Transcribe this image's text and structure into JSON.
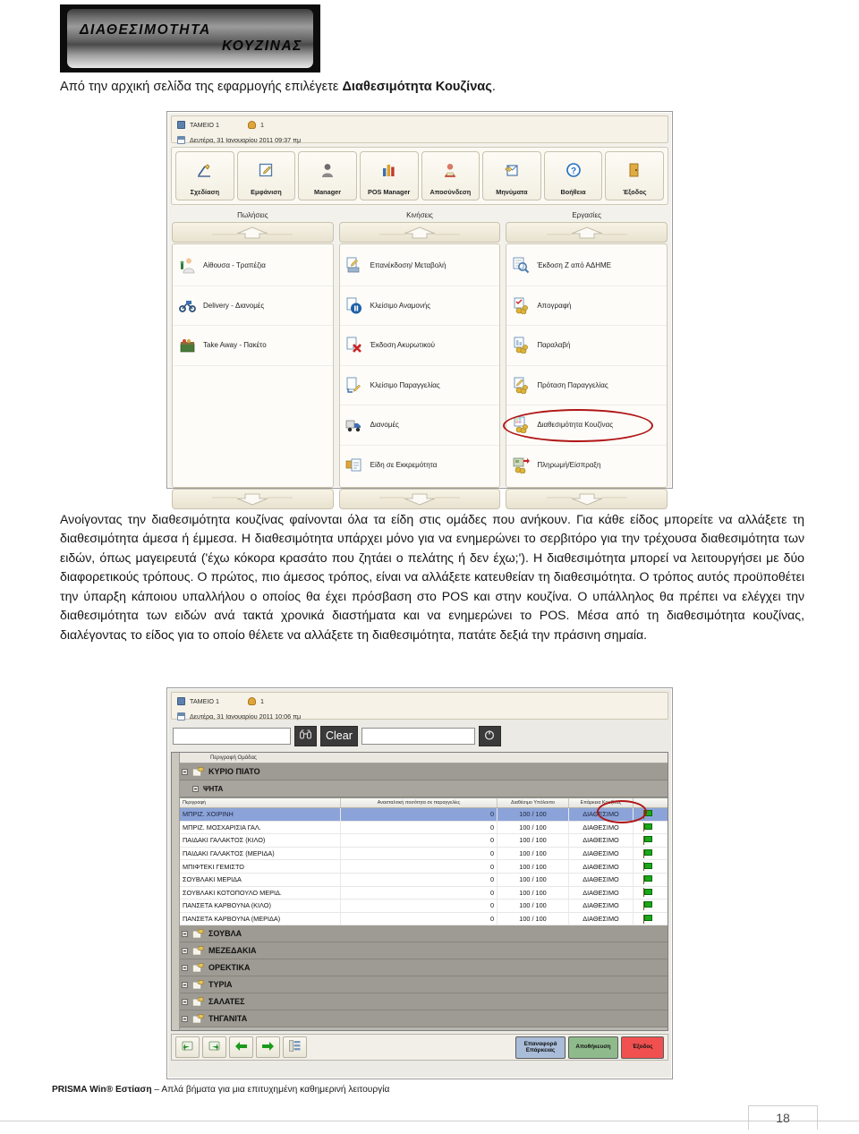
{
  "banner": {
    "line1": "ΔΙΑΘΕΣΙΜΟΤΗΤΑ",
    "line2": "ΚΟΥΖΙΝΑΣ"
  },
  "intro": {
    "text_before": "Από την αρχική σελίδα της εφαρμογής επιλέγετε ",
    "text_bold": "Διαθεσιμότητα Κουζίνας",
    "text_after": "."
  },
  "paragraph": {
    "text": "Ανοίγοντας την διαθεσιμότητα κουζίνας φαίνονται όλα τα είδη στις ομάδες που ανήκουν. Για κάθε είδος μπορείτε να αλλάξετε τη διαθεσιμότητα άμεσα ή έμμεσα. Η διαθεσιμότητα υπάρχει μόνο για να ενημερώνει το σερβιτόρο για την τρέχουσα διαθεσιμότητα των ειδών, όπως μαγειρευτά ('έχω κόκορα κρασάτο που ζητάει ο πελάτης ή δεν έχω;'). Η διαθεσιμότητα μπορεί να λειτουργήσει με δύο διαφορετικούς τρόπους. Ο πρώτος, πιο άμεσος τρόπος, είναι να αλλάξετε κατευθείαν τη διαθεσιμότητα. Ο τρόπος αυτός προϋποθέτει την ύπαρξη κάποιου υπαλλήλου ο οποίος θα έχει πρόσβαση στο POS και στην κουζίνα. Ο υπάλληλος θα πρέπει να ελέγχει την διαθεσιμότητα των ειδών ανά τακτά χρονικά διαστήματα και να ενημερώνει το POS. Μέσα από τη διαθεσιμότητα κουζίνας, διαλέγοντας το είδος για το οποίο θέλετε να αλλάξετε τη διαθεσιμότητα, πατάτε δεξιά την πράσινη σημαία."
  },
  "screenshot1": {
    "status": {
      "terminal": "ΤΑΜΕΙΟ 1",
      "user": "1",
      "datetime": "Δευτέρα, 31 Ιανουαρίου 2011 09:37 πμ"
    },
    "toolbar": [
      {
        "label": "Σχεδίαση",
        "icon": "design-icon"
      },
      {
        "label": "Εμφάνιση",
        "icon": "view-icon"
      },
      {
        "label": "Manager",
        "icon": "manager-icon"
      },
      {
        "label": "POS Manager",
        "icon": "chart-icon"
      },
      {
        "label": "Αποσύνδεση",
        "icon": "logout-icon"
      },
      {
        "label": "Μηνύματα",
        "icon": "messages-icon"
      },
      {
        "label": "Βοήθεια",
        "icon": "help-icon"
      },
      {
        "label": "Έξοδος",
        "icon": "exit-icon"
      }
    ],
    "columns": [
      {
        "title": "Πωλήσεις",
        "items": [
          {
            "label": "Αίθουσα - Τραπέζια",
            "icon": "waiter-icon"
          },
          {
            "label": "Delivery - Διανομές",
            "icon": "scooter-icon"
          },
          {
            "label": "Take Away - Πακέτο",
            "icon": "takeaway-icon"
          }
        ]
      },
      {
        "title": "Κινήσεις",
        "items": [
          {
            "label": "Επανέκδοση/ Μεταβολή",
            "icon": "reissue-icon"
          },
          {
            "label": "Κλείσιμο Αναμονής",
            "icon": "pause-icon"
          },
          {
            "label": "Έκδοση Ακυρωτικού",
            "icon": "cancel-doc-icon"
          },
          {
            "label": "Κλείσιμο Παραγγελίας",
            "icon": "close-order-icon"
          },
          {
            "label": "Διανομές",
            "icon": "delivery-truck-icon"
          },
          {
            "label": "Είδη σε Εκκρεμότητα",
            "icon": "pending-items-icon"
          }
        ]
      },
      {
        "title": "Εργασίες",
        "items": [
          {
            "label": "Έκδοση Ζ από ΑΔΗΜΕ",
            "icon": "z-report-icon"
          },
          {
            "label": "Απογραφή",
            "icon": "inventory-icon"
          },
          {
            "label": "Παραλαβή",
            "icon": "receive-icon"
          },
          {
            "label": "Πρόταση Παραγγελίας",
            "icon": "order-proposal-icon"
          },
          {
            "label": "Διαθεσιμότητα Κουζίνας",
            "icon": "kitchen-availability-icon",
            "highlighted": true
          },
          {
            "label": "Πληρωμή/Είσπραξη",
            "icon": "payment-icon"
          }
        ]
      }
    ]
  },
  "screenshot2": {
    "status": {
      "terminal": "ΤΑΜΕΙΟ 1",
      "user": "1",
      "datetime": "Δευτέρα, 31 Ιανουαρίου 2011 10:06 πμ"
    },
    "search": {
      "field1_value": "",
      "field2_value": "",
      "clear_label": "Clear",
      "find_icon": "binoculars-icon",
      "refresh_icon": "power-icon"
    },
    "tree_column_header": "Περιγραφή Ομάδας",
    "group_top": "ΚΥΡΙΟ ΠΙΑΤΟ",
    "group_sub": "ΨΗΤΑ",
    "table": {
      "headers": [
        "Περιγραφή",
        "Ανασταλτική ποσότητα σε παραγγελίες",
        "Διαθέσιμο Υπόλοιπο",
        "Επάρκεια Κουζίνας",
        ""
      ],
      "rows": [
        {
          "desc": "ΜΠΡΙΖ. ΧΟΙΡΙΝΗ",
          "qty": "0",
          "balance": "100 / 100",
          "status": "ΔΙΑΘΕΣΙΜΟ",
          "flag": "green-flag-icon",
          "selected": true
        },
        {
          "desc": "ΜΠΡΙΖ. ΜΟΣΧΑΡΙΣΙΑ ΓΑΛ.",
          "qty": "0",
          "balance": "100 / 100",
          "status": "ΔΙΑΘΕΣΙΜΟ",
          "flag": "green-flag-icon",
          "selected": false
        },
        {
          "desc": "ΠΑΙΔΑΚΙ ΓΑΛΑΚΤΟΣ (ΚΙΛΟ)",
          "qty": "0",
          "balance": "100 / 100",
          "status": "ΔΙΑΘΕΣΙΜΟ",
          "flag": "green-flag-icon",
          "selected": false
        },
        {
          "desc": "ΠΑΙΔΑΚΙ ΓΑΛΑΚΤΟΣ (ΜΕΡΙΔΑ)",
          "qty": "0",
          "balance": "100 / 100",
          "status": "ΔΙΑΘΕΣΙΜΟ",
          "flag": "green-flag-icon",
          "selected": false
        },
        {
          "desc": "ΜΠΙΦΤΕΚΙ ΓΕΜΙΣΤΟ",
          "qty": "0",
          "balance": "100 / 100",
          "status": "ΔΙΑΘΕΣΙΜΟ",
          "flag": "green-flag-icon",
          "selected": false
        },
        {
          "desc": "ΣΟΥΒΛΑΚΙ ΜΕΡΙΔΑ",
          "qty": "0",
          "balance": "100 / 100",
          "status": "ΔΙΑΘΕΣΙΜΟ",
          "flag": "green-flag-icon",
          "selected": false
        },
        {
          "desc": "ΣΟΥΒΛΑΚΙ ΚΟΤΟΠΟΥΛΟ ΜΕΡΙΔ.",
          "qty": "0",
          "balance": "100 / 100",
          "status": "ΔΙΑΘΕΣΙΜΟ",
          "flag": "green-flag-icon",
          "selected": false
        },
        {
          "desc": "ΠΑΝΣΕΤΑ ΚΑΡΒΟΥΝΑ (ΚΙΛΟ)",
          "qty": "0",
          "balance": "100 / 100",
          "status": "ΔΙΑΘΕΣΙΜΟ",
          "flag": "green-flag-icon",
          "selected": false
        },
        {
          "desc": "ΠΑΝΣΕΤΑ ΚΑΡΒΟΥΝΑ (ΜΕΡΙΔΑ)",
          "qty": "0",
          "balance": "100 / 100",
          "status": "ΔΙΑΘΕΣΙΜΟ",
          "flag": "green-flag-icon",
          "selected": false
        }
      ]
    },
    "groups_below": [
      "ΣΟΥΒΛΑ",
      "ΜΕΖΕΔΑΚΙΑ",
      "ΟΡΕΚΤΙΚΑ",
      "ΤΥΡΙΑ",
      "ΣΑΛΑΤΕΣ",
      "ΤΗΓΑΝΙΤΑ"
    ],
    "bottom_buttons": {
      "nav": [
        {
          "icon": "expand-all-icon"
        },
        {
          "icon": "collapse-all-icon"
        },
        {
          "icon": "arrow-left-icon"
        },
        {
          "icon": "arrow-right-icon"
        },
        {
          "icon": "list-icon"
        }
      ],
      "restore_label": "Επαναφορά Επάρκειας",
      "save_label": "Αποθήκευση",
      "exit_label": "Έξοδος"
    }
  },
  "footer": {
    "brand": "PRISMA Win® Εστίαση",
    "tagline": " – Απλά βήματα για μια επιτυχημένη καθημερινή λειτουργία",
    "page_number": "18"
  },
  "colors": {
    "highlight_red": "#b01616",
    "selected_row": "#8ba3d8",
    "save_green": "#8fbb8c",
    "exit_red": "#f05050",
    "restore_blue": "#a9bcd8",
    "flag_green": "#1aa81a"
  }
}
